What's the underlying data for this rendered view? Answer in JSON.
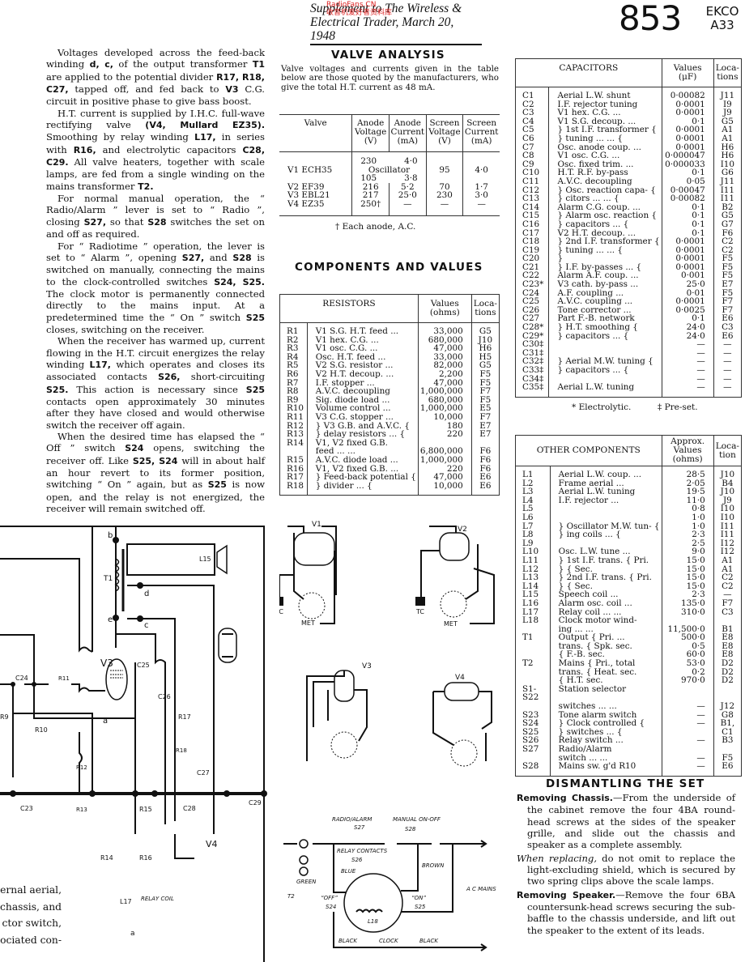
{
  "header": {
    "publication_line1": "Supplement to The Wireless &",
    "publication_line2": "Electrical Trader, March 20, 1948",
    "sheet_number": "853",
    "make": "EKCO",
    "model": "A33"
  },
  "circuit_text": {
    "paragraphs": [
      "Voltages developed across the feed-back winding <b>d, c,</b> of the output transformer <b>T1</b> are applied to the potential divider <b>R17, R18, C27,</b> tapped off, and fed back to <b>V3</b> C.G. circuit in positive phase to give bass boost.",
      "H.T. current is supplied by I.H.C. full-wave rectifying valve <b>(V4, Mullard EZ35).</b> Smoothing by relay winding <b>L17,</b> in series with <b>R16,</b> and electrolytic capacitors <b>C28, C29.</b> All valve heaters, together with scale lamps, are fed from a single winding on the mains transformer <b>T2.</b>",
      "For normal manual operation, the “ Radio/Alarm ” lever is set to “ Radio ”, closing <b>S27,</b> so that <b>S28</b> switches the set on and off as required.",
      "For “ Radiotime ” operation, the lever is set to “ Alarm ”, opening <b>S27,</b> and <b>S28</b> is switched on manually, connecting the mains to the clock-controlled switches <b>S24, S25.</b> The clock motor is permanently connected directly to the mains input. At a predetermined time the “ On ” switch <b>S25</b> closes, switching on the receiver.",
      "When the receiver has warmed up, current flowing in the H.T. circuit energizes the relay winding <b>L17,</b> which operates and closes its associated contacts <b>S26,</b> short-circuiting <b>S25.</b> This action is necessary since <b>S25</b> contacts open approximately 30 minutes after they have closed and would otherwise switch the receiver off again.",
      "When the desired time has elapsed the “ Off ” switch <b>S24</b> opens, switching the receiver off. Like <b>S25, S24</b> will in about half an hour revert to its former position, switching “ On ” again, but as <b>S25</b> is now open, and the relay is not energized, the receiver will remain switched off."
    ],
    "cut_off_fragments": [
      "ernal aerial,",
      "chassis, and",
      "ctor switch,",
      "ociated con-"
    ]
  },
  "valve_analysis": {
    "title": "VALVE ANALYSIS",
    "intro": "Valve voltages and currents given in the table below are those quoted by the manufacturers, who give the total H.T. current as 48 mA.",
    "columns": [
      "Valve",
      "Anode Voltage (V)",
      "Anode Current (mA)",
      "Screen Voltage (V)",
      "Screen Current (mA)"
    ],
    "rows": [
      {
        "valve": "V1 ECH35",
        "anode_v": "230",
        "anode_ma": "4·0",
        "osc_label": "Oscillator",
        "osc_anode_v": "105",
        "osc_anode_ma": "3·8",
        "screen_v": "95",
        "screen_ma": "4·0"
      },
      {
        "valve": "V2 EF39",
        "anode_v": "216",
        "anode_ma": "5·2",
        "screen_v": "70",
        "screen_ma": "1·7"
      },
      {
        "valve": "V3 EBL21",
        "anode_v": "217",
        "anode_ma": "25·0",
        "screen_v": "230",
        "screen_ma": "3·0"
      },
      {
        "valve": "V4 EZ35",
        "anode_v": "250†",
        "anode_ma": "—",
        "screen_v": "—",
        "screen_ma": "—"
      }
    ],
    "footnote": "† Each anode, A.C."
  },
  "components": {
    "title": "COMPONENTS AND VALUES",
    "resistors": {
      "header": "RESISTORS",
      "values_header": "Values (ohms)",
      "loc_header": "Loca-tions",
      "rows": [
        [
          "R1",
          "V1 S.G. H.T. feed ...",
          "33,000",
          "G5"
        ],
        [
          "R2",
          "V1 hex. C.G.      ...",
          "680,000",
          "J10"
        ],
        [
          "R3",
          "V1 osc. C.G.      ...",
          "47,000",
          "H6"
        ],
        [
          "R4",
          "Osc. H.T. feed    ...",
          "33,000",
          "H5"
        ],
        [
          "R5",
          "V2 S.G. resistor  ...",
          "82,000",
          "G5"
        ],
        [
          "R6",
          "V2 H.T. decoup.  ...",
          "2,200",
          "F5"
        ],
        [
          "R7",
          "I.F. stopper       ...",
          "47,000",
          "F5"
        ],
        [
          "R8",
          "A.V.C. decoupling",
          "1,000,000",
          "F7"
        ],
        [
          "R9",
          "Sig. diode load   ...",
          "680,000",
          "F5"
        ],
        [
          "R10",
          "Volume control   ...",
          "1,000,000",
          "E5"
        ],
        [
          "R11",
          "V3 C.G. stopper  ...",
          "10,000",
          "F7"
        ],
        [
          "R12",
          "} V3 G.B. and A.V.C. {",
          "180",
          "E7"
        ],
        [
          "R13",
          "}   delay resistors ... {",
          "220",
          "E7"
        ],
        [
          "R14",
          "V1, V2 fixed G.B.",
          "",
          ""
        ],
        [
          "",
          "   feed      ...    ...",
          "6,800,000",
          "F6"
        ],
        [
          "R15",
          "A.V.C. diode load ...",
          "1,000,000",
          "F6"
        ],
        [
          "R16",
          "V1, V2 fixed G.B. ...",
          "220",
          "F6"
        ],
        [
          "R17",
          "} Feed-back potential {",
          "47,000",
          "E6"
        ],
        [
          "R18",
          "}   divider   ...   {",
          "10,000",
          "E6"
        ]
      ]
    },
    "capacitors": {
      "header": "CAPACITORS",
      "values_header": "Values (μF)",
      "loc_header": "Loca-tions",
      "rows": [
        [
          "C1",
          "Aerial L.W. shunt",
          "0·00082",
          "J11"
        ],
        [
          "C2",
          "I.F. rejector tuning",
          "0·0001",
          "I9"
        ],
        [
          "C3",
          "V1 hex. C.G.      ...",
          "0·0001",
          "J9"
        ],
        [
          "C4",
          "V1 S.G. decoup.  ...",
          "0·1",
          "G5"
        ],
        [
          "C5",
          "} 1st I.F. transformer {",
          "0·0001",
          "A1"
        ],
        [
          "C6",
          "}   tuning  ...   ... {",
          "0·0001",
          "A1"
        ],
        [
          "C7",
          "Osc. anode coup.  ...",
          "0·0001",
          "H6"
        ],
        [
          "C8",
          "V1 osc. C.G.      ...",
          "0·000047",
          "H6"
        ],
        [
          "C9",
          "Osc. fixed trim.  ...",
          "0·000033",
          "I10"
        ],
        [
          "C10",
          "H.T. R.F. by-pass",
          "0·1",
          "G6"
        ],
        [
          "C11",
          "A.V.C. decoupling",
          "0·05",
          "J11"
        ],
        [
          "C12",
          "} Osc. reaction capa- {",
          "0·00047",
          "I11"
        ],
        [
          "C13",
          "}   citors   ...   ... {",
          "0·00082",
          "I11"
        ],
        [
          "C14",
          "Alarm C.G. coup. ...",
          "0·1",
          "B2"
        ],
        [
          "C15",
          "} Alarm osc. reaction {",
          "0·1",
          "G5"
        ],
        [
          "C16",
          "}   capacitors   ... {",
          "0·1",
          "G7"
        ],
        [
          "C17",
          "V2 H.T. decoup.  ...",
          "0·1",
          "F6"
        ],
        [
          "C18",
          "} 2nd I.F. transformer {",
          "0·0001",
          "C2"
        ],
        [
          "C19",
          "}   tuning  ...   ... {",
          "0·0001",
          "C2"
        ],
        [
          "C20",
          "}",
          "0·0001",
          "F5"
        ],
        [
          "C21",
          "} I.F. by-passes  ... {",
          "0·0001",
          "F5"
        ],
        [
          "C22",
          "Alarm A.F. coup. ...",
          "0·001",
          "F5"
        ],
        [
          "C23*",
          "V3 cath. by-pass ...",
          "25·0",
          "E7"
        ],
        [
          "C24",
          "A.F. coupling     ...",
          "0·01",
          "F5"
        ],
        [
          "C25",
          "A.V.C. coupling   ...",
          "0·0001",
          "F7"
        ],
        [
          "C26",
          "Tone corrector    ...",
          "0·0025",
          "F7"
        ],
        [
          "C27",
          "Part F.-B. network",
          "0·1",
          "E6"
        ],
        [
          "C28*",
          "} H.T. smoothing  {",
          "24·0",
          "C3"
        ],
        [
          "C29*",
          "}   capacitors  ... {",
          "24·0",
          "E6"
        ],
        [
          "C30‡",
          "",
          "—",
          "—"
        ],
        [
          "C31‡",
          "",
          "—",
          "—"
        ],
        [
          "C32‡",
          "} Aerial M.W. tuning {",
          "—",
          "—"
        ],
        [
          "C33‡",
          "}   capacitors  ... {",
          "—",
          "—"
        ],
        [
          "C34‡",
          "",
          "—",
          "—"
        ],
        [
          "C35‡",
          "Aerial L.W. tuning",
          "—",
          "—"
        ]
      ],
      "footnote_electrolytic": "* Electrolytic.",
      "footnote_preset": "‡ Pre-set."
    },
    "other": {
      "header": "OTHER COMPONENTS",
      "values_header": "Approx. Values (ohms)",
      "loc_header": "Loca-tion",
      "rows": [
        [
          "L1",
          "Aerial L.W. coup. ...",
          "28·5",
          "J10"
        ],
        [
          "L2",
          "Frame aerial      ...",
          "2·05",
          "B4"
        ],
        [
          "L3",
          "Aerial L.W. tuning",
          "19·5",
          "J10"
        ],
        [
          "L4",
          "I.F. rejector      ...",
          "11·0",
          "J9"
        ],
        [
          "L5",
          "",
          "0·8",
          "I10"
        ],
        [
          "L6",
          "",
          "1·0",
          "I10"
        ],
        [
          "L7",
          "} Oscillator M.W. tun- {",
          "1·0",
          "I11"
        ],
        [
          "L8",
          "}   ing coils     ... {",
          "2·3",
          "I11"
        ],
        [
          "L9",
          "",
          "2·5",
          "I12"
        ],
        [
          "L10",
          "Osc. L.W. tune   ...",
          "9·0",
          "I12"
        ],
        [
          "L11",
          "} 1st I.F. trans. { Pri.",
          "15·0",
          "A1"
        ],
        [
          "L12",
          "}                 { Sec.",
          "15·0",
          "A1"
        ],
        [
          "L13",
          "} 2nd I.F. trans. { Pri.",
          "15·0",
          "C2"
        ],
        [
          "L14",
          "}                 { Sec.",
          "15·0",
          "C2"
        ],
        [
          "L15",
          "Speech coil       ...",
          "2·3",
          "—"
        ],
        [
          "L16",
          "Alarm osc. coil   ...",
          "135·0",
          "F7"
        ],
        [
          "L17",
          "Relay coil ...    ...",
          "310·0",
          "C3"
        ],
        [
          "L18",
          "Clock motor wind-",
          "",
          ""
        ],
        [
          "",
          "   ing      ...    ...",
          "11,500·0",
          "B1"
        ],
        [
          "T1",
          "Output { Pri.      ...",
          "500·0",
          "E8"
        ],
        [
          "",
          "trans.  { Spk. sec.",
          "0·5",
          "E8"
        ],
        [
          "",
          "        { F.-B. sec.",
          "60·0",
          "E8"
        ],
        [
          "T2",
          "Mains { Pri., total",
          "53·0",
          "D2"
        ],
        [
          "",
          "trans. { Heat. sec.",
          "0·2",
          "D2"
        ],
        [
          "",
          "       { H.T. sec.",
          "970·0",
          "D2"
        ],
        [
          "S1-S22",
          "Station selector",
          "",
          ""
        ],
        [
          "",
          "   switches ...   ...",
          "—",
          "J12"
        ],
        [
          "S23",
          "Tone alarm switch",
          "—",
          "G8"
        ],
        [
          "S24",
          "} Clock controlled {",
          "—",
          "B1,"
        ],
        [
          "S25",
          "}   switches     ... {",
          "",
          "C1"
        ],
        [
          "S26",
          "Relay switch      ...",
          "—",
          "B3"
        ],
        [
          "S27",
          "Radio/Alarm",
          "",
          ""
        ],
        [
          "",
          "   switch  ...    ...",
          "—",
          "F5"
        ],
        [
          "S28",
          "Mains sw. g'd R10",
          "—",
          "E6"
        ]
      ]
    }
  },
  "dismantling": {
    "title": "DISMANTLING THE SET",
    "items": [
      {
        "lead": "Removing Chassis.",
        "style": "bold",
        "text": "—From the underside of the cabinet remove the four 4BA round-head screws at the sides of the speaker grille, and slide out the chassis and speaker as a complete assembly."
      },
      {
        "lead": "When replacing,",
        "style": "italic",
        "text": " do not omit to replace the light-excluding shield, which is secured by two spring clips above the scale lamps."
      },
      {
        "lead": "Removing Speaker.",
        "style": "bold",
        "text": "—Remove the four 6BA countersunk-head screws securing the sub-baffle to the chassis underside, and lift out the speaker to the extent of its leads."
      }
    ]
  },
  "schematic": {
    "labels": {
      "b": "b",
      "c": "c",
      "d": "d",
      "e": "e",
      "a": "a",
      "T1": "T1",
      "L15": "L15",
      "V3": "V3",
      "V4": "V4",
      "C24": "C24",
      "C25": "C25",
      "C26": "C26",
      "C27": "C27",
      "C23": "C23",
      "C28": "C28",
      "C29": "C29",
      "R9": "R9",
      "R10": "R10",
      "R11": "R11",
      "R12": "R12",
      "R13": "R13",
      "R14": "R14",
      "R15": "R15",
      "R16": "R16",
      "R17": "R17",
      "R18": "R18",
      "L17": "L17",
      "relay_coil": "RELAY COIL",
      "T2": "T2",
      "L18": "L18",
      "radio_alarm": "RADIO/ALARM",
      "S27": "S27",
      "manual_on_off": "MANUAL ON-OFF",
      "S28": "S28",
      "relay_contacts": "RELAY CONTACTS",
      "S26": "S26",
      "blue": "BLUE",
      "brown": "BROWN",
      "green": "GREEN",
      "off": "“OFF”",
      "S24": "S24",
      "on": "“ON”",
      "S25": "S25",
      "black": "BLACK",
      "clock": "CLOCK",
      "ac_mains": "A C MAINS",
      "plus": "+",
      "minus": "–"
    },
    "base_diagrams": {
      "V1": "V1",
      "V2": "V2",
      "V3": "V3",
      "V4": "V4",
      "tc": "TC",
      "met": "MET"
    }
  },
  "watermark": {
    "site": "RadioFans.CN",
    "chinese": "收音机爱好者资料库"
  }
}
